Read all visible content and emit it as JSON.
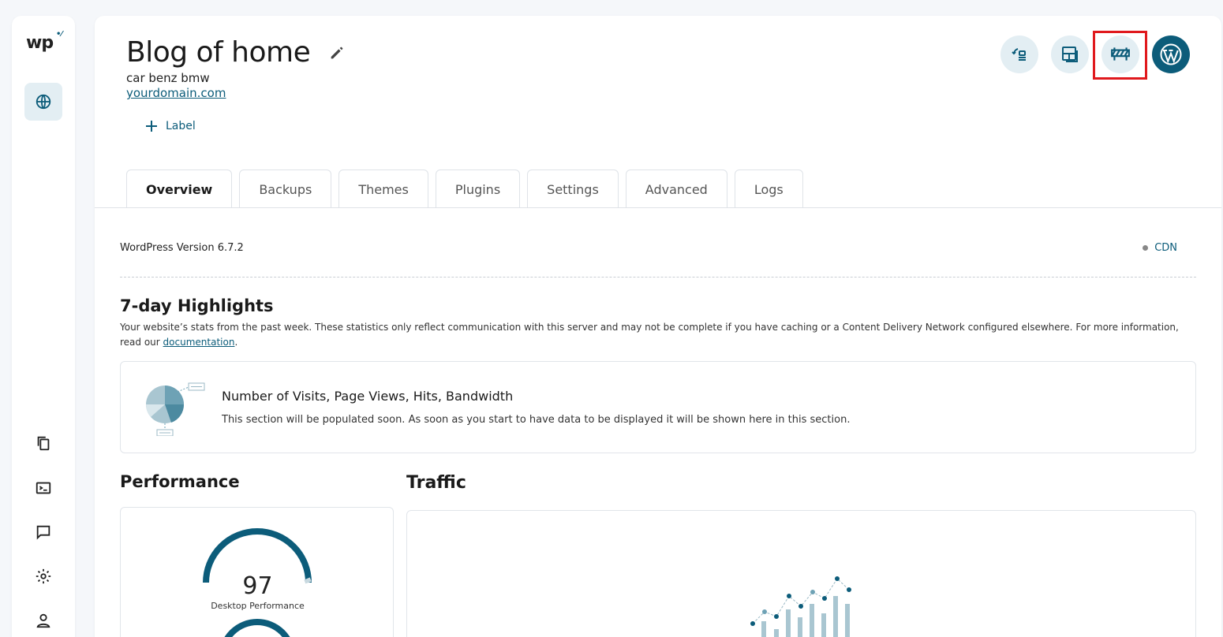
{
  "sidebar": {
    "logo": "wp",
    "icons": [
      "globe-icon",
      "copy-icon",
      "terminal-icon",
      "chat-icon",
      "gear-icon",
      "user-icon"
    ]
  },
  "header": {
    "title": "Blog of home",
    "subtitle": "car benz bmw",
    "domain": "yourdomain.com",
    "add_label": "Label",
    "actions": [
      "restore-icon",
      "layout-icon",
      "maintenance-barrier-icon",
      "wordpress-icon"
    ]
  },
  "tabs": [
    "Overview",
    "Backups",
    "Themes",
    "Plugins",
    "Settings",
    "Advanced",
    "Logs"
  ],
  "overview": {
    "wp_version": "WordPress Version 6.7.2",
    "cdn_label": "CDN",
    "highlights_title": "7-day Highlights",
    "highlights_desc": "Your website’s stats from the past week. These statistics only reflect communication with this server and may not be complete if you have caching or a Content Delivery Network configured elsewhere. For more information, read our ",
    "highlights_link": "documentation",
    "highlights_end": ".",
    "empty_title": "Number of Visits, Page Views, Hits, Bandwidth",
    "empty_text": "This section will be populated soon. As soon as you start to have data to be displayed it will be shown here in this section.",
    "performance_title": "Performance",
    "desktop_score": "97",
    "desktop_label": "Desktop Performance",
    "traffic_title": "Traffic"
  },
  "colors": {
    "accent": "#0c5c7a",
    "accent_light": "#e3eef3",
    "highlight_box": "#e0191d"
  }
}
